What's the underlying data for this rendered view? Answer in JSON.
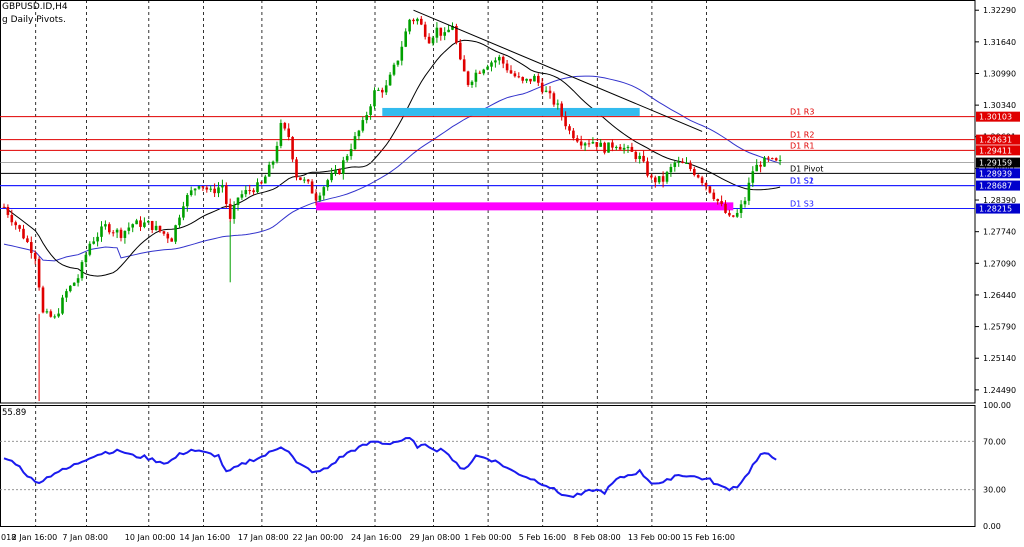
{
  "header": {
    "symbol_line": "GBPUSD.ID,H4",
    "indicator_line": "g Daily Pivots."
  },
  "rsi_panel": {
    "value_label": "55.89",
    "levels": [
      "100.00",
      "70.00",
      "30.00",
      "0.00"
    ]
  },
  "colors": {
    "background": "#ffffff",
    "candle_bull": "#00a000",
    "candle_bear": "#e00000",
    "resistance": "#e00000",
    "support": "#1a1aff",
    "pivot": "#000000",
    "ma_blue": "#3333cc",
    "ma_black": "#000000",
    "zone_cyan": "#33bbee",
    "zone_magenta": "#ff00ff",
    "rsi_line": "#1a1aee",
    "grid": "#000000",
    "price_tag_red": "#e00000",
    "price_tag_blue": "#0000cc"
  },
  "chart_data": [
    {
      "type": "candlestick",
      "title": "",
      "y_ticks": [
        "1.32290",
        "1.31640",
        "1.30990",
        "1.30340",
        "1.29691",
        "1.29041",
        "1.28390",
        "1.27740",
        "1.27090",
        "1.26440",
        "1.25790",
        "1.25140",
        "1.24490"
      ],
      "ylim": [
        1.2422,
        1.325
      ],
      "x_ticks": [
        "018",
        "2 Jan 16:00",
        "7 Jan 08:00",
        "10 Jan 00:00",
        "14 Jan 16:00",
        "17 Jan 08:00",
        "22 Jan 00:00",
        "24 Jan 16:00",
        "29 Jan 08:00",
        "1 Feb 00:00",
        "5 Feb 16:00",
        "8 Feb 08:00",
        "13 Feb 00:00",
        "15 Feb 16:00"
      ],
      "pivot_levels": [
        {
          "name": "D1 R3",
          "value": 1.30103,
          "tag": "1.30103",
          "kind": "resistance"
        },
        {
          "name": "D1 R2",
          "value": 1.29631,
          "tag": "1.29631",
          "kind": "resistance"
        },
        {
          "name": "D1 R1",
          "value": 1.29411,
          "tag": "1.29411",
          "kind": "resistance"
        },
        {
          "name": "D1 Pivot",
          "value": 1.28939,
          "tag": "1.28939",
          "kind": "pivot"
        },
        {
          "name": "D1 S1",
          "value": 1.28687,
          "tag": "1.28687",
          "kind": "support"
        },
        {
          "name": "D1 S2",
          "value": 1.28687,
          "tag": "",
          "kind": "support"
        },
        {
          "name": "D1 S3",
          "value": 1.28215,
          "tag": "1.28215",
          "kind": "support"
        }
      ],
      "current_price": {
        "value": 1.29159,
        "tag": "1.29159"
      },
      "zones": [
        {
          "name": "resistance-zone",
          "price": 1.302,
          "from_bar": 97,
          "to_bar": 163,
          "color": "#33bbee"
        },
        {
          "name": "support-zone",
          "price": 1.2826,
          "from_bar": 80,
          "to_bar": 187,
          "color": "#ff00ff"
        }
      ],
      "trendline": {
        "from": {
          "bar": 105,
          "price": 1.3229
        },
        "to": {
          "bar": 179,
          "price": 1.298
        }
      },
      "waypoints": [
        [
          0,
          1.2825
        ],
        [
          5,
          1.2765
        ],
        [
          8,
          1.2725
        ],
        [
          10,
          1.2605
        ],
        [
          13,
          1.2595
        ],
        [
          16,
          1.265
        ],
        [
          19,
          1.268
        ],
        [
          22,
          1.275
        ],
        [
          26,
          1.2785
        ],
        [
          30,
          1.277
        ],
        [
          33,
          1.279
        ],
        [
          37,
          1.279
        ],
        [
          40,
          1.2775
        ],
        [
          43,
          1.276
        ],
        [
          46,
          1.2835
        ],
        [
          50,
          1.2875
        ],
        [
          53,
          1.2855
        ],
        [
          56,
          1.287
        ],
        [
          58,
          1.2795
        ],
        [
          60,
          1.2845
        ],
        [
          63,
          1.286
        ],
        [
          66,
          1.287
        ],
        [
          69,
          1.292
        ],
        [
          71,
          1.299
        ],
        [
          73,
          1.297
        ],
        [
          75,
          1.289
        ],
        [
          78,
          1.287
        ],
        [
          80,
          1.2845
        ],
        [
          83,
          1.288
        ],
        [
          86,
          1.29
        ],
        [
          89,
          1.295
        ],
        [
          92,
          1.2995
        ],
        [
          95,
          1.306
        ],
        [
          98,
          1.307
        ],
        [
          101,
          1.313
        ],
        [
          104,
          1.321
        ],
        [
          106,
          1.321
        ],
        [
          109,
          1.317
        ],
        [
          111,
          1.319
        ],
        [
          113,
          1.3175
        ],
        [
          115,
          1.32
        ],
        [
          117,
          1.312
        ],
        [
          119,
          1.308
        ],
        [
          121,
          1.31
        ],
        [
          124,
          1.312
        ],
        [
          127,
          1.313
        ],
        [
          130,
          1.31
        ],
        [
          133,
          1.308
        ],
        [
          136,
          1.309
        ],
        [
          139,
          1.306
        ],
        [
          142,
          1.303
        ],
        [
          145,
          1.298
        ],
        [
          148,
          1.296
        ],
        [
          151,
          1.296
        ],
        [
          154,
          1.2945
        ],
        [
          157,
          1.2955
        ],
        [
          160,
          1.294
        ],
        [
          163,
          1.2925
        ],
        [
          166,
          1.288
        ],
        [
          169,
          1.288
        ],
        [
          172,
          1.2915
        ],
        [
          175,
          1.291
        ],
        [
          178,
          1.289
        ],
        [
          181,
          1.286
        ],
        [
          184,
          1.2825
        ],
        [
          186,
          1.28
        ],
        [
          188,
          1.281
        ],
        [
          190,
          1.284
        ],
        [
          192,
          1.29
        ],
        [
          194,
          1.2915
        ],
        [
          196,
          1.292
        ],
        [
          198,
          1.2915
        ]
      ]
    },
    {
      "type": "line",
      "title": "RSI",
      "last_value": 55.89,
      "ylim": [
        0,
        100
      ],
      "levels": [
        70,
        30
      ],
      "rsi_values": [
        [
          0,
          56
        ],
        [
          3,
          52
        ],
        [
          6,
          42
        ],
        [
          8,
          36
        ],
        [
          10,
          38
        ],
        [
          13,
          44
        ],
        [
          16,
          47
        ],
        [
          19,
          52
        ],
        [
          22,
          57
        ],
        [
          26,
          61
        ],
        [
          30,
          62
        ],
        [
          33,
          58
        ],
        [
          36,
          57
        ],
        [
          39,
          54
        ],
        [
          42,
          52
        ],
        [
          45,
          59
        ],
        [
          48,
          63
        ],
        [
          52,
          60
        ],
        [
          55,
          58
        ],
        [
          57,
          44
        ],
        [
          60,
          49
        ],
        [
          63,
          54
        ],
        [
          66,
          57
        ],
        [
          69,
          62
        ],
        [
          71,
          66
        ],
        [
          73,
          62
        ],
        [
          75,
          52
        ],
        [
          78,
          47
        ],
        [
          80,
          44
        ],
        [
          83,
          48
        ],
        [
          86,
          56
        ],
        [
          89,
          62
        ],
        [
          92,
          66
        ],
        [
          95,
          70
        ],
        [
          98,
          68
        ],
        [
          101,
          70
        ],
        [
          104,
          72
        ],
        [
          106,
          66
        ],
        [
          109,
          66
        ],
        [
          111,
          63
        ],
        [
          113,
          63
        ],
        [
          115,
          55
        ],
        [
          117,
          47
        ],
        [
          119,
          50
        ],
        [
          121,
          58
        ],
        [
          124,
          56
        ],
        [
          127,
          52
        ],
        [
          130,
          46
        ],
        [
          133,
          42
        ],
        [
          136,
          38
        ],
        [
          139,
          34
        ],
        [
          142,
          28
        ],
        [
          145,
          24
        ],
        [
          148,
          26
        ],
        [
          151,
          30
        ],
        [
          154,
          28
        ],
        [
          157,
          38
        ],
        [
          160,
          42
        ],
        [
          163,
          45
        ],
        [
          166,
          36
        ],
        [
          169,
          35
        ],
        [
          172,
          42
        ],
        [
          175,
          42
        ],
        [
          178,
          40
        ],
        [
          181,
          38
        ],
        [
          184,
          32
        ],
        [
          186,
          31
        ],
        [
          188,
          33
        ],
        [
          190,
          40
        ],
        [
          192,
          50
        ],
        [
          194,
          58
        ],
        [
          196,
          60
        ],
        [
          198,
          56
        ]
      ]
    }
  ]
}
